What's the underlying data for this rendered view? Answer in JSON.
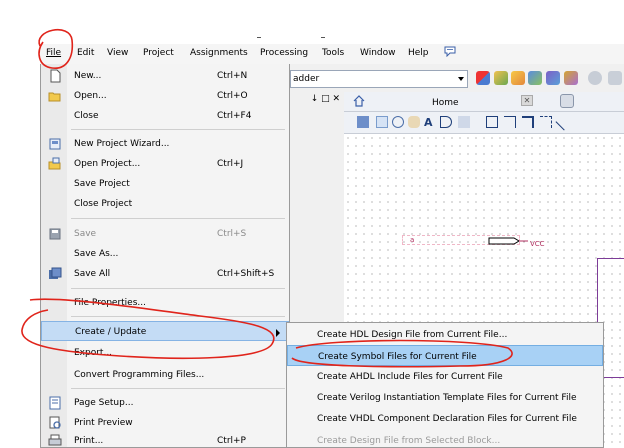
{
  "menubar": {
    "items": [
      {
        "label": "File"
      },
      {
        "label": "Edit"
      },
      {
        "label": "View"
      },
      {
        "label": "Project"
      },
      {
        "label": "Assignments"
      },
      {
        "label": "Processing"
      },
      {
        "label": "Tools"
      },
      {
        "label": "Window"
      },
      {
        "label": "Help"
      }
    ]
  },
  "toolbar": {
    "project_combo_value": "adder"
  },
  "panel": {
    "title_glyphs": "↓ □ ✕"
  },
  "home_tab": {
    "label": "Home",
    "close_label": "✕"
  },
  "schematic": {
    "pin_label": "a",
    "vcc_label": "VCC"
  },
  "file_menu": {
    "items": [
      {
        "label": "New...",
        "shortcut": "Ctrl+N",
        "icon": "new-file-icon"
      },
      {
        "label": "Open...",
        "shortcut": "Ctrl+O",
        "icon": "open-folder-icon"
      },
      {
        "label": "Close",
        "shortcut": "Ctrl+F4",
        "icon": ""
      },
      {
        "label": "New Project Wizard...",
        "shortcut": "",
        "icon": "project-wizard-icon"
      },
      {
        "label": "Open Project...",
        "shortcut": "Ctrl+J",
        "icon": "open-project-icon"
      },
      {
        "label": "Save Project",
        "shortcut": "",
        "icon": ""
      },
      {
        "label": "Close Project",
        "shortcut": "",
        "icon": ""
      },
      {
        "label": "Save",
        "shortcut": "Ctrl+S",
        "icon": "save-icon"
      },
      {
        "label": "Save As...",
        "shortcut": "",
        "icon": ""
      },
      {
        "label": "Save All",
        "shortcut": "Ctrl+Shift+S",
        "icon": "save-all-icon"
      },
      {
        "label": "File Properties...",
        "shortcut": "",
        "icon": ""
      },
      {
        "label": "Create / Update",
        "shortcut": "",
        "icon": ""
      },
      {
        "label": "Export...",
        "shortcut": "",
        "icon": ""
      },
      {
        "label": "Convert Programming Files...",
        "shortcut": "",
        "icon": ""
      },
      {
        "label": "Page Setup...",
        "shortcut": "",
        "icon": "page-setup-icon"
      },
      {
        "label": "Print Preview",
        "shortcut": "",
        "icon": "print-preview-icon"
      },
      {
        "label": "Print...",
        "shortcut": "Ctrl+P",
        "icon": "printer-icon"
      }
    ]
  },
  "submenu": {
    "items": [
      {
        "label": "Create HDL Design File from Current File..."
      },
      {
        "label": "Create Symbol Files for Current File"
      },
      {
        "label": "Create AHDL Include Files for Current File"
      },
      {
        "label": "Create Verilog Instantiation Template Files for Current File"
      },
      {
        "label": "Create VHDL Component Declaration Files for Current File"
      },
      {
        "label": "Create Design File from Selected Block..."
      }
    ]
  },
  "colors": {
    "annotation_red": "#e0241b",
    "highlight": "#c4dcf5",
    "wire_pink": "#b03060",
    "block_purple": "#7d3c98"
  }
}
